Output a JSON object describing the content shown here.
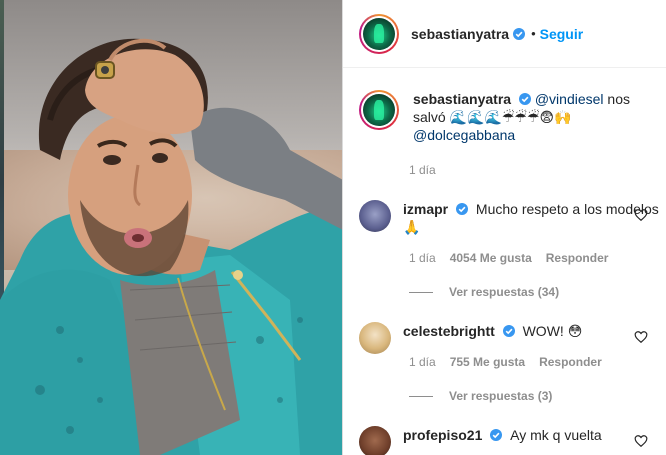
{
  "post": {
    "author": "sebastianyatra",
    "follow_label": "Seguir",
    "separator": "•"
  },
  "caption": {
    "author": "sebastianyatra",
    "mention1": "@vindiesel",
    "text1": " nos salvó ",
    "emoji_sequence": "🌊🌊🌊☔☔☔😨🙌",
    "mention2": "@dolcegabbana",
    "time": "1 día"
  },
  "comments": [
    {
      "user": "izmapr",
      "text": "Mucho respeto a los modelos",
      "emoji": "🙏",
      "time": "1 día",
      "likes": "4054 Me gusta",
      "reply_label": "Responder",
      "view_replies": "Ver respuestas (34)"
    },
    {
      "user": "celestebrightt",
      "text": "WOW!",
      "emoji": "😳",
      "time": "1 día",
      "likes": "755 Me gusta",
      "reply_label": "Responder",
      "view_replies": "Ver respuestas (3)"
    },
    {
      "user": "profepiso21",
      "text": "Ay mk q vuelta"
    }
  ],
  "colors": {
    "accent": "#0095f6",
    "verified": "#3897f0",
    "mention": "#00376b",
    "meta": "#8e8e8e"
  },
  "icons": {
    "verified": "verified-badge-icon",
    "heart": "heart-icon"
  }
}
